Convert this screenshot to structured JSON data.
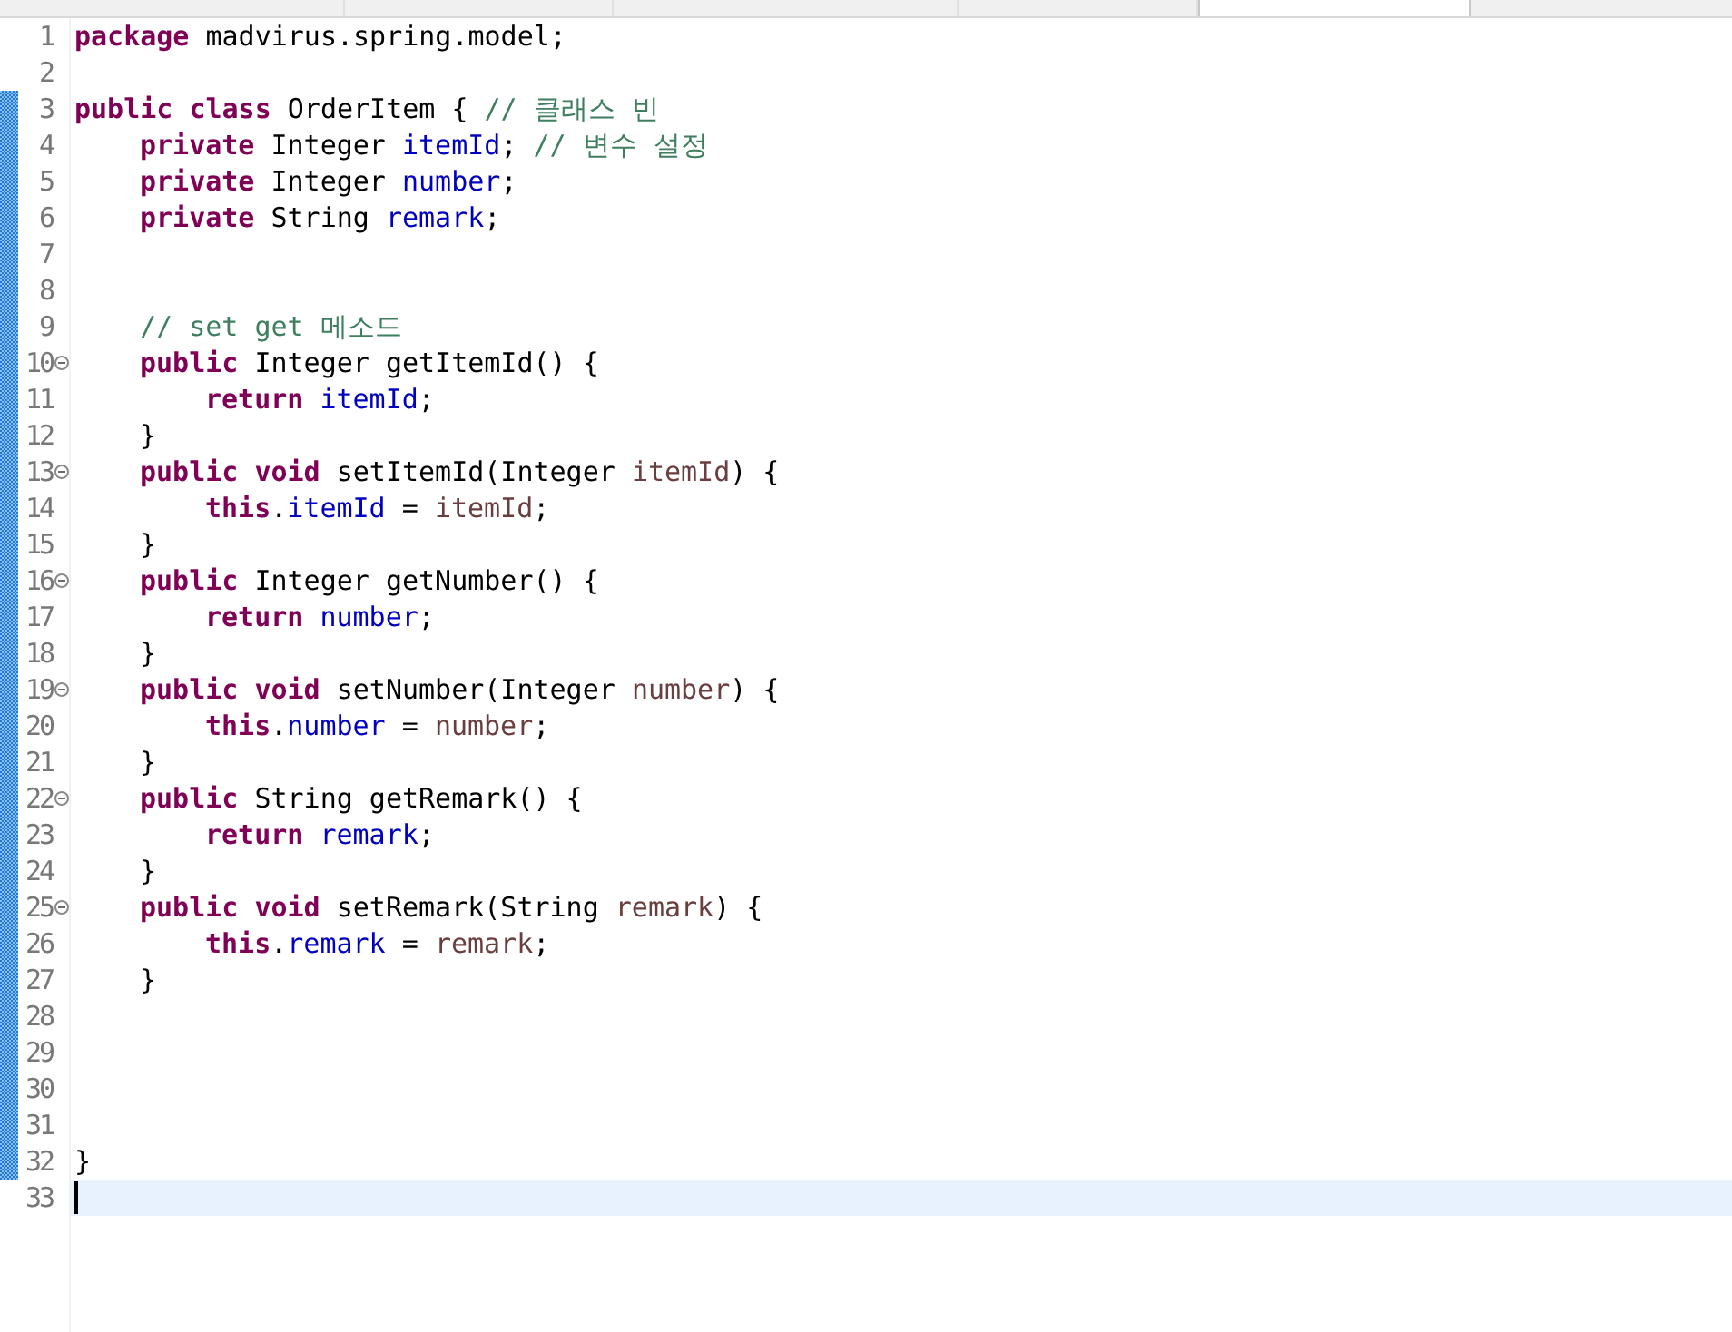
{
  "tabs": [
    {
      "selected": false
    },
    {
      "selected": false
    },
    {
      "selected": false
    },
    {
      "selected": false
    },
    {
      "selected": true
    }
  ],
  "lines": [
    {
      "number": "1",
      "changed": false,
      "foldable": false,
      "current": false,
      "tokens": [
        {
          "kind": "keyword",
          "text": "package "
        },
        {
          "kind": "plain",
          "text": "madvirus.spring.model;"
        }
      ]
    },
    {
      "number": "2",
      "changed": false,
      "foldable": false,
      "current": false
    },
    {
      "number": "3",
      "changed": true,
      "foldable": false,
      "current": false,
      "tokens": [
        {
          "kind": "keyword",
          "text": "public "
        },
        {
          "kind": "keyword",
          "text": "class "
        },
        {
          "kind": "plain",
          "text": "OrderItem { "
        },
        {
          "kind": "comment",
          "text": "// 클래스 빈"
        }
      ],
      "children": [
        {
          "number": "4",
          "changed": true,
          "foldable": false,
          "current": false,
          "tokens": [
            {
              "kind": "keyword",
              "text": "private "
            },
            {
              "kind": "plain",
              "text": "Integer "
            },
            {
              "kind": "field",
              "text": "itemId"
            },
            {
              "kind": "plain",
              "text": "; "
            },
            {
              "kind": "comment",
              "text": "// 변수 설정"
            }
          ]
        },
        {
          "number": "5",
          "changed": true,
          "foldable": false,
          "current": false,
          "tokens": [
            {
              "kind": "keyword",
              "text": "private "
            },
            {
              "kind": "plain",
              "text": "Integer "
            },
            {
              "kind": "field",
              "text": "number"
            },
            {
              "kind": "plain",
              "text": ";"
            }
          ]
        },
        {
          "number": "6",
          "changed": true,
          "foldable": false,
          "current": false,
          "tokens": [
            {
              "kind": "keyword",
              "text": "private "
            },
            {
              "kind": "plain",
              "text": "String "
            },
            {
              "kind": "field",
              "text": "remark"
            },
            {
              "kind": "plain",
              "text": ";"
            }
          ]
        },
        {
          "number": "7",
          "changed": true,
          "foldable": false,
          "current": false
        },
        {
          "number": "8",
          "changed": true,
          "foldable": false,
          "current": false
        },
        {
          "number": "9",
          "changed": true,
          "foldable": false,
          "current": false,
          "tokens": [
            {
              "kind": "comment",
              "text": "// set get 메소드"
            }
          ]
        },
        {
          "number": "10",
          "changed": true,
          "foldable": true,
          "current": false,
          "tokens": [
            {
              "kind": "keyword",
              "text": "public "
            },
            {
              "kind": "plain",
              "text": "Integer getItemId() {"
            }
          ],
          "children": [
            {
              "number": "11",
              "changed": true,
              "foldable": false,
              "current": false,
              "tokens": [
                {
                  "kind": "keyword",
                  "text": "return "
                },
                {
                  "kind": "field",
                  "text": "itemId"
                },
                {
                  "kind": "plain",
                  "text": ";"
                }
              ]
            }
          ]
        },
        {
          "number": "12",
          "changed": true,
          "foldable": false,
          "current": false,
          "tokens": [
            {
              "kind": "plain",
              "text": "}"
            }
          ]
        },
        {
          "number": "13",
          "changed": true,
          "foldable": true,
          "current": false,
          "tokens": [
            {
              "kind": "keyword",
              "text": "public "
            },
            {
              "kind": "keyword",
              "text": "void "
            },
            {
              "kind": "plain",
              "text": "setItemId(Integer "
            },
            {
              "kind": "param",
              "text": "itemId"
            },
            {
              "kind": "plain",
              "text": ") {"
            }
          ],
          "children": [
            {
              "number": "14",
              "changed": true,
              "foldable": false,
              "current": false,
              "tokens": [
                {
                  "kind": "keyword",
                  "text": "this"
                },
                {
                  "kind": "plain",
                  "text": "."
                },
                {
                  "kind": "field",
                  "text": "itemId"
                },
                {
                  "kind": "plain",
                  "text": " = "
                },
                {
                  "kind": "param",
                  "text": "itemId"
                },
                {
                  "kind": "plain",
                  "text": ";"
                }
              ]
            }
          ]
        },
        {
          "number": "15",
          "changed": true,
          "foldable": false,
          "current": false,
          "tokens": [
            {
              "kind": "plain",
              "text": "}"
            }
          ]
        },
        {
          "number": "16",
          "changed": true,
          "foldable": true,
          "current": false,
          "tokens": [
            {
              "kind": "keyword",
              "text": "public "
            },
            {
              "kind": "plain",
              "text": "Integer getNumber() {"
            }
          ],
          "children": [
            {
              "number": "17",
              "changed": true,
              "foldable": false,
              "current": false,
              "tokens": [
                {
                  "kind": "keyword",
                  "text": "return "
                },
                {
                  "kind": "field",
                  "text": "number"
                },
                {
                  "kind": "plain",
                  "text": ";"
                }
              ]
            }
          ]
        },
        {
          "number": "18",
          "changed": true,
          "foldable": false,
          "current": false,
          "tokens": [
            {
              "kind": "plain",
              "text": "}"
            }
          ]
        },
        {
          "number": "19",
          "changed": true,
          "foldable": true,
          "current": false,
          "tokens": [
            {
              "kind": "keyword",
              "text": "public "
            },
            {
              "kind": "keyword",
              "text": "void "
            },
            {
              "kind": "plain",
              "text": "setNumber(Integer "
            },
            {
              "kind": "param",
              "text": "number"
            },
            {
              "kind": "plain",
              "text": ") {"
            }
          ],
          "children": [
            {
              "number": "20",
              "changed": true,
              "foldable": false,
              "current": false,
              "tokens": [
                {
                  "kind": "keyword",
                  "text": "this"
                },
                {
                  "kind": "plain",
                  "text": "."
                },
                {
                  "kind": "field",
                  "text": "number"
                },
                {
                  "kind": "plain",
                  "text": " = "
                },
                {
                  "kind": "param",
                  "text": "number"
                },
                {
                  "kind": "plain",
                  "text": ";"
                }
              ]
            }
          ]
        },
        {
          "number": "21",
          "changed": true,
          "foldable": false,
          "current": false,
          "tokens": [
            {
              "kind": "plain",
              "text": "}"
            }
          ]
        },
        {
          "number": "22",
          "changed": true,
          "foldable": true,
          "current": false,
          "tokens": [
            {
              "kind": "keyword",
              "text": "public "
            },
            {
              "kind": "plain",
              "text": "String getRemark() {"
            }
          ],
          "children": [
            {
              "number": "23",
              "changed": true,
              "foldable": false,
              "current": false,
              "tokens": [
                {
                  "kind": "keyword",
                  "text": "return "
                },
                {
                  "kind": "field",
                  "text": "remark"
                },
                {
                  "kind": "plain",
                  "text": ";"
                }
              ]
            }
          ]
        },
        {
          "number": "24",
          "changed": true,
          "foldable": false,
          "current": false,
          "tokens": [
            {
              "kind": "plain",
              "text": "}"
            }
          ]
        },
        {
          "number": "25",
          "changed": true,
          "foldable": true,
          "current": false,
          "tokens": [
            {
              "kind": "keyword",
              "text": "public "
            },
            {
              "kind": "keyword",
              "text": "void "
            },
            {
              "kind": "plain",
              "text": "setRemark(String "
            },
            {
              "kind": "param",
              "text": "remark"
            },
            {
              "kind": "plain",
              "text": ") {"
            }
          ],
          "children": [
            {
              "number": "26",
              "changed": true,
              "foldable": false,
              "current": false,
              "tokens": [
                {
                  "kind": "keyword",
                  "text": "this"
                },
                {
                  "kind": "plain",
                  "text": "."
                },
                {
                  "kind": "field",
                  "text": "remark"
                },
                {
                  "kind": "plain",
                  "text": " = "
                },
                {
                  "kind": "param",
                  "text": "remark"
                },
                {
                  "kind": "plain",
                  "text": ";"
                }
              ]
            }
          ]
        },
        {
          "number": "27",
          "changed": true,
          "foldable": false,
          "current": false,
          "tokens": [
            {
              "kind": "plain",
              "text": "}"
            }
          ]
        },
        {
          "number": "28",
          "changed": true,
          "foldable": false,
          "current": false
        },
        {
          "number": "29",
          "changed": true,
          "foldable": false,
          "current": false
        },
        {
          "number": "30",
          "changed": true,
          "foldable": false,
          "current": false
        },
        {
          "number": "31",
          "changed": true,
          "foldable": false,
          "current": false
        }
      ]
    },
    {
      "number": "32",
      "changed": true,
      "foldable": false,
      "current": false,
      "tokens": [
        {
          "kind": "plain",
          "text": "}"
        }
      ]
    },
    {
      "number": "33",
      "changed": false,
      "foldable": false,
      "current": true
    }
  ]
}
